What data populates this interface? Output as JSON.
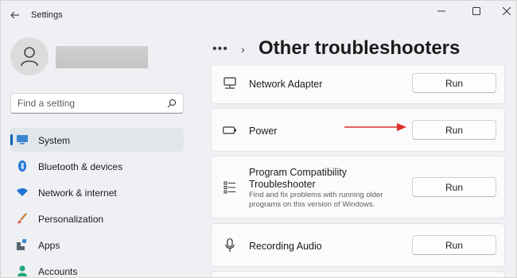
{
  "window": {
    "app_title": "Settings"
  },
  "sidebar": {
    "search": {
      "placeholder": "Find a setting"
    },
    "items": [
      {
        "label": "System",
        "icon": "monitor-icon",
        "active": true
      },
      {
        "label": "Bluetooth & devices",
        "icon": "bluetooth-icon"
      },
      {
        "label": "Network & internet",
        "icon": "wifi-icon"
      },
      {
        "label": "Personalization",
        "icon": "brush-icon"
      },
      {
        "label": "Apps",
        "icon": "apps-icon"
      },
      {
        "label": "Accounts",
        "icon": "person-icon"
      }
    ]
  },
  "main": {
    "breadcrumb_overflow": "•••",
    "title": "Other troubleshooters",
    "troubleshooters": [
      {
        "title": "Network Adapter",
        "icon": "network-adapter-icon",
        "button": "Run"
      },
      {
        "title": "Power",
        "icon": "battery-icon",
        "button": "Run"
      },
      {
        "title": "Program Compatibility",
        "title_line2": "Troubleshooter",
        "description": "Find and fix problems with running older programs on this version of Windows.",
        "icon": "list-icon",
        "button": "Run"
      },
      {
        "title": "Recording Audio",
        "icon": "microphone-icon",
        "button": "Run"
      }
    ]
  },
  "colors": {
    "accent": "#005fb8",
    "annotation_arrow": "#d9302c"
  }
}
